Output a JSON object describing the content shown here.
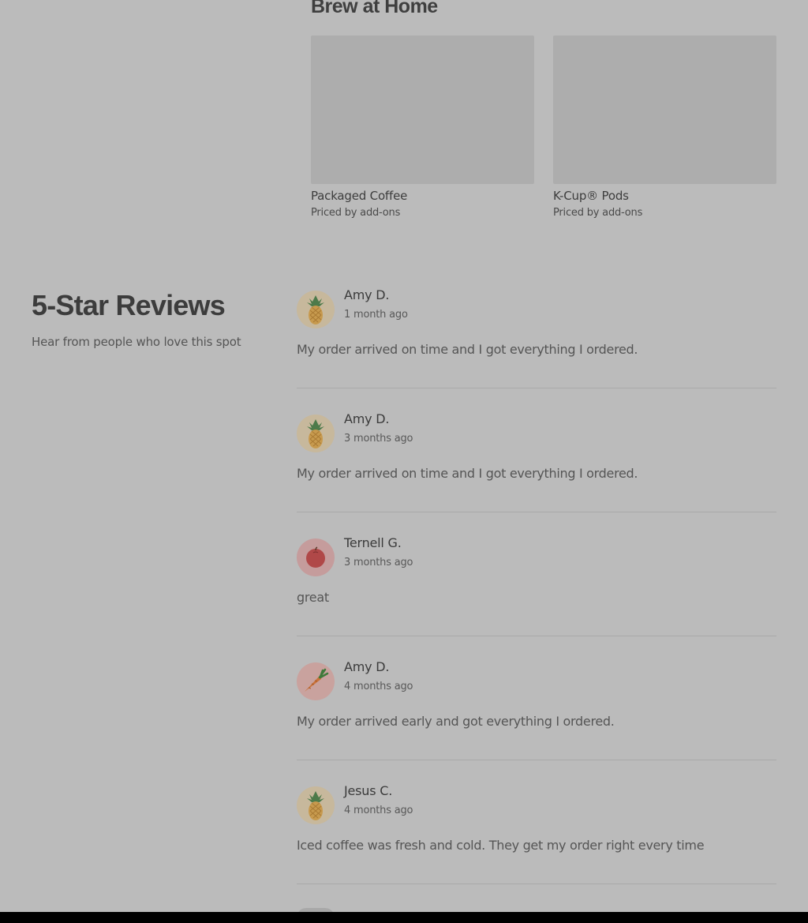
{
  "brew": {
    "title": "Brew at Home",
    "items": [
      {
        "name": "Packaged Coffee",
        "price": "Priced by add-ons"
      },
      {
        "name": "K-Cup® Pods",
        "price": "Priced by add-ons"
      }
    ]
  },
  "reviews": {
    "title": "5-Star Reviews",
    "subtitle": "Hear from people who love this spot",
    "items": [
      {
        "name": "Amy D.",
        "time": "1 month ago",
        "text": "My order arrived on time and I got everything I ordered.",
        "avatar": "pineapple-icon"
      },
      {
        "name": "Amy D.",
        "time": "3 months ago",
        "text": "My order arrived on time and I got everything I ordered.",
        "avatar": "pineapple-icon"
      },
      {
        "name": "Ternell G.",
        "time": "3 months ago",
        "text": "great",
        "avatar": "apple-icon"
      },
      {
        "name": "Amy D.",
        "time": "4 months ago",
        "text": "My order arrived early and got everything I ordered.",
        "avatar": "carrot-icon"
      },
      {
        "name": "Jesus C.",
        "time": "4 months ago",
        "text": "Iced coffee was fresh and cold. They get my order right every time",
        "avatar": "pineapple-icon"
      }
    ]
  }
}
